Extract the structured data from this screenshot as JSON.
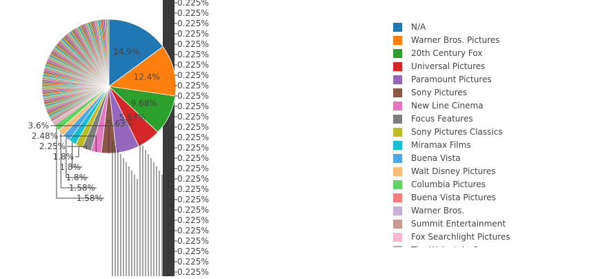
{
  "chart_data": {
    "type": "pie",
    "title": "",
    "slices": [
      {
        "label": "N/A",
        "percent": 14.9,
        "color": "#1f77b4"
      },
      {
        "label": "Warner Bros. Pictures",
        "percent": 12.4,
        "color": "#ff7f0e"
      },
      {
        "label": "20th Century Fox",
        "percent": 9.68,
        "color": "#2ca02c"
      },
      {
        "label": "Universal Pictures",
        "percent": 5.63,
        "color": "#d62728"
      },
      {
        "label": "Paramount Pictures",
        "percent": 5.63,
        "color": "#9467bd"
      },
      {
        "label": "Sony Pictures",
        "percent": 3.6,
        "color": "#8c564b"
      },
      {
        "label": "New Line Cinema",
        "percent": 2.48,
        "color": "#e377c2"
      },
      {
        "label": "Focus Features",
        "percent": 2.25,
        "color": "#7f7f7f"
      },
      {
        "label": "Sony Pictures Classics",
        "percent": 1.8,
        "color": "#bcbd22"
      },
      {
        "label": "Miramax Films",
        "percent": 1.8,
        "color": "#17becf"
      },
      {
        "label": "Buena Vista",
        "percent": 1.8,
        "color": "#4aa8e8"
      },
      {
        "label": "Walt Disney Pictures",
        "percent": 1.58,
        "color": "#ffbb78"
      },
      {
        "label": "Columbia Pictures",
        "percent": 1.58,
        "color": "#5fd35f"
      },
      {
        "label": "Buena Vista Pictures",
        "percent": null,
        "color": "#f07f7f"
      },
      {
        "label": "Warner Bros.",
        "percent": null,
        "color": "#c5b0d5"
      },
      {
        "label": "Summit Entertainment",
        "percent": null,
        "color": "#c49c94"
      },
      {
        "label": "Fox Searchlight Pictures",
        "percent": null,
        "color": "#f7b6d2"
      },
      {
        "label": "The Weinstein Company",
        "percent": null,
        "color": "#aaaaaa"
      }
    ],
    "visible_small_slice_label": "0.225%",
    "small_slice_label_count": 27,
    "legend_position": "right"
  },
  "tail_palette": [
    "#1f77b4",
    "#ff7f0e",
    "#2ca02c",
    "#d62728",
    "#9467bd",
    "#8c564b",
    "#e377c2",
    "#7f7f7f",
    "#bcbd22",
    "#17becf"
  ]
}
